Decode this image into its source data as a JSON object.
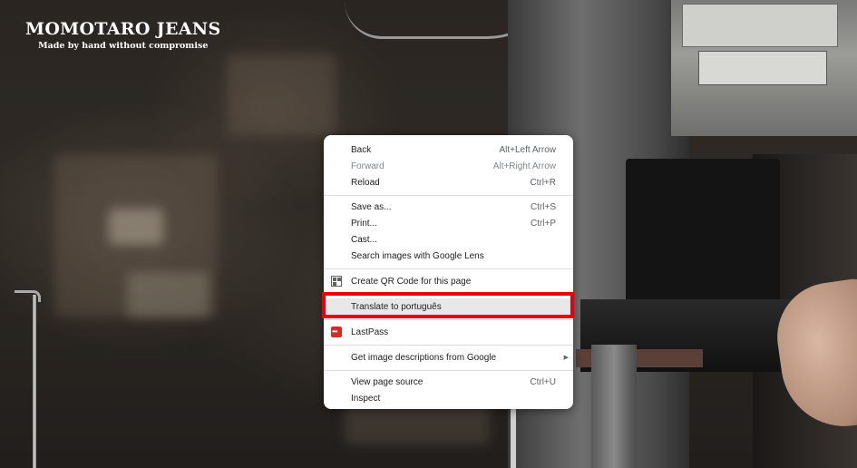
{
  "brand": {
    "title": "MOMOTARO JEANS",
    "tagline": "Made by hand without compromise"
  },
  "context_menu": {
    "groups": [
      [
        {
          "label": "Back",
          "shortcut": "Alt+Left Arrow",
          "enabled": true
        },
        {
          "label": "Forward",
          "shortcut": "Alt+Right Arrow",
          "enabled": false
        },
        {
          "label": "Reload",
          "shortcut": "Ctrl+R",
          "enabled": true
        }
      ],
      [
        {
          "label": "Save as...",
          "shortcut": "Ctrl+S",
          "enabled": true
        },
        {
          "label": "Print...",
          "shortcut": "Ctrl+P",
          "enabled": true
        },
        {
          "label": "Cast...",
          "shortcut": "",
          "enabled": true
        },
        {
          "label": "Search images with Google Lens",
          "shortcut": "",
          "enabled": true
        }
      ],
      [
        {
          "label": "Create QR Code for this page",
          "icon": "qr-code-icon"
        }
      ],
      [
        {
          "label": "Translate to português",
          "highlighted": true
        }
      ],
      [
        {
          "label": "LastPass",
          "icon": "lastpass-icon"
        }
      ],
      [
        {
          "label": "Get image descriptions from Google",
          "submenu": true
        }
      ],
      [
        {
          "label": "View page source",
          "shortcut": "Ctrl+U"
        },
        {
          "label": "Inspect",
          "shortcut": ""
        }
      ]
    ]
  },
  "colors": {
    "highlight_frame": "#e8000b",
    "lastpass_red": "#d32d27",
    "menu_bg": "#ffffff"
  }
}
